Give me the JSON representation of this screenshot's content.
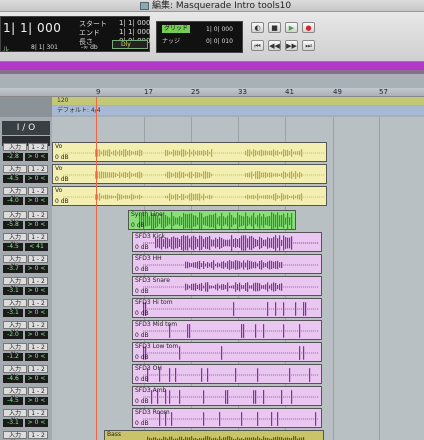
{
  "window": {
    "title": "編集: Masquerade Intro tools10"
  },
  "transport": {
    "main_counter": "1| 1| 000",
    "labels": [
      "スタート",
      "エンド",
      "長さ"
    ],
    "values": [
      "1| 1| 000",
      "1| 1| 000",
      "0| 0| 000"
    ],
    "sub_left": "ル",
    "sub_mid": "8| 1| 301",
    "sub_db": "-∞ db",
    "dly": "Dly",
    "grid_label": "グリッド",
    "grid_value": "1| 0| 000",
    "nudge_label": "ナッジ",
    "nudge_value": "0| 0| 010"
  },
  "ruler": {
    "ticks": [
      "9",
      "17",
      "25",
      "33",
      "41",
      "49",
      "57"
    ]
  },
  "tempo": {
    "value": "120",
    "meter": "デフォルト: 4/4"
  },
  "io_header": "I / O",
  "tracks": [
    {
      "in": "入力 No",
      "ch": "1 - 2",
      "vol": "-2.8",
      "pan": "> 0 <"
    },
    {
      "in": "入力 No",
      "ch": "1 - 2",
      "vol": "-4.5",
      "pan": "> 0 <"
    },
    {
      "in": "入力 No",
      "ch": "1 - 2",
      "vol": "-4.0",
      "pan": "> 0 <"
    },
    {
      "in": "入力 No",
      "ch": "1 - 2",
      "vol": "-5.8",
      "pan": "> 0 <"
    },
    {
      "in": "入力 No",
      "ch": "1 - 2",
      "vol": "-4.5",
      "pan": "< 41"
    },
    {
      "in": "入力 No",
      "ch": "1 - 2",
      "vol": "-3.7",
      "pan": "> 0 <"
    },
    {
      "in": "入力 No",
      "ch": "1 - 2",
      "vol": "-3.1",
      "pan": "> 0 <"
    },
    {
      "in": "入力 No",
      "ch": "1 - 2",
      "vol": "-3.1",
      "pan": "> 0 <"
    },
    {
      "in": "入力 No",
      "ch": "1 - 2",
      "vol": "-2.0",
      "pan": "> 0 <"
    },
    {
      "in": "入力 No",
      "ch": "1 - 2",
      "vol": "-1.2",
      "pan": "> 0 <"
    },
    {
      "in": "入力 No",
      "ch": "1 - 2",
      "vol": "-4.6",
      "pan": "> 0 <"
    },
    {
      "in": "入力 No",
      "ch": "1 - 2",
      "vol": "-4.5",
      "pan": "> 0 <"
    },
    {
      "in": "入力 No",
      "ch": "1 - 2",
      "vol": "-3.1",
      "pan": "> 0 <"
    },
    {
      "in": "入力 No",
      "ch": "1 - 2",
      "vol": "-2.8",
      "pan": "> 0 <"
    }
  ],
  "clips": [
    {
      "name": "Vo",
      "db": "0 dB",
      "color": "y"
    },
    {
      "name": "Vo",
      "db": "0 dB",
      "color": "y"
    },
    {
      "name": "Vo",
      "db": "0 dB",
      "color": "y"
    },
    {
      "name": "Synth Line",
      "db": "0 dB",
      "color": "g"
    },
    {
      "name": "SFD3 Kick",
      "db": "0 dB",
      "color": "p"
    },
    {
      "name": "SFD3 HH",
      "db": "0 dB",
      "color": "p"
    },
    {
      "name": "SFD3 Snare",
      "db": "0 dB",
      "color": "p"
    },
    {
      "name": "SFD3 Hi tom",
      "db": "0 dB",
      "color": "p"
    },
    {
      "name": "SFD3 Mid tom",
      "db": "0 dB",
      "color": "p"
    },
    {
      "name": "SFD3 Low tom",
      "db": "0 dB",
      "color": "p"
    },
    {
      "name": "SFD3 OH",
      "db": "0 dB",
      "color": "p"
    },
    {
      "name": "SFD3 Amb",
      "db": "0 dB",
      "color": "p"
    },
    {
      "name": "SFD3 Room",
      "db": "0 dB",
      "color": "p"
    },
    {
      "name": "Bass",
      "db": "0 dB",
      "color": "k"
    }
  ]
}
